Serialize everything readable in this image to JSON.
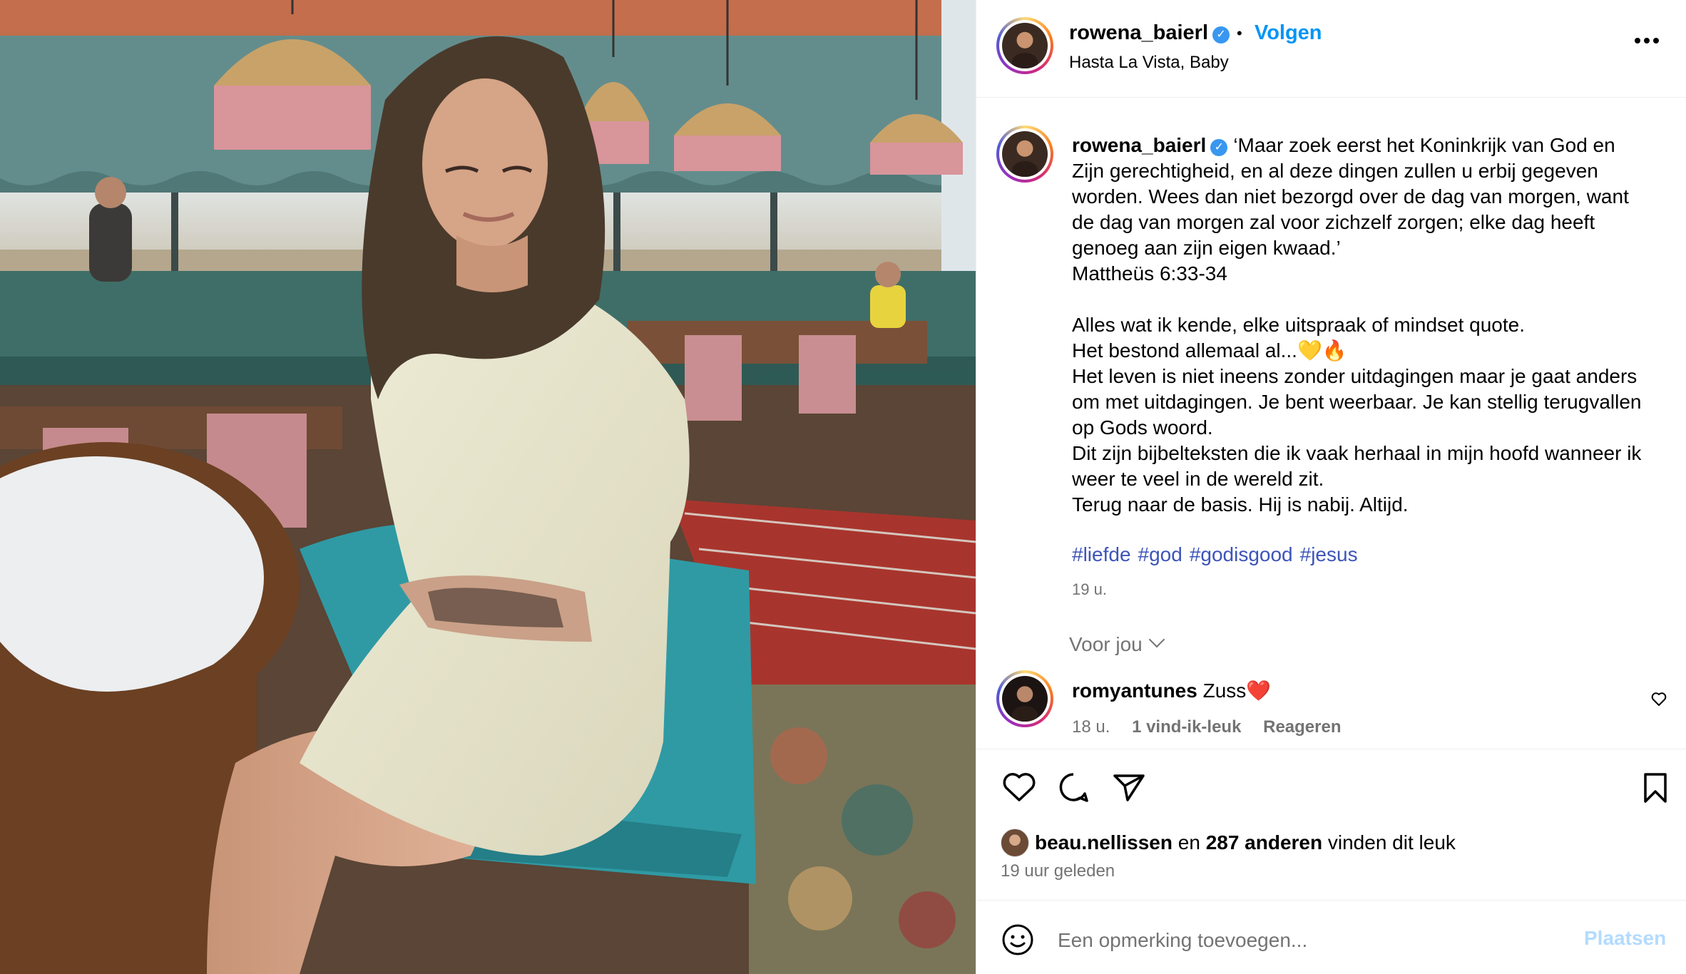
{
  "header": {
    "username": "rowena_baierl",
    "separator": "•",
    "follow_label": "Volgen",
    "subtitle": "Hasta La Vista, Baby"
  },
  "caption": {
    "username": "rowena_baierl",
    "lines": [
      "‘Maar zoek eerst het Koninkrijk van God en",
      "Zijn gerechtigheid, en al deze dingen zullen u erbij gegeven",
      "worden. Wees dan niet bezorgd over de dag van morgen, want",
      "de dag van morgen zal voor zichzelf zorgen; elke dag heeft",
      "genoeg aan zijn eigen kwaad.’",
      "Mattheüs 6:33-34",
      "",
      "Alles wat ik kende, elke uitspraak of mindset quote.",
      "Het bestond allemaal al...💛🔥",
      "Het leven is niet ineens zonder uitdagingen maar je gaat anders",
      "om met uitdagingen. Je bent weerbaar. Je kan stellig terugvallen",
      "op Gods woord.",
      "Dit zijn bijbelteksten die ik vaak herhaal in mijn hoofd wanneer ik",
      "weer te veel in de wereld zit.",
      "Terug naar de basis. Hij is nabij. Altijd."
    ],
    "hashtags": [
      "#liefde",
      "#god",
      "#godisgood",
      "#jesus"
    ],
    "time": "19 u."
  },
  "for_you": "Voor jou",
  "comment": {
    "username": "romyantunes",
    "text": "Zuss❤️",
    "time": "18 u.",
    "likes": "1 vind-ik-leuk",
    "reply": "Reageren"
  },
  "likes": {
    "user": "beau.nellissen",
    "and": "en",
    "count_text": "287 anderen",
    "suffix": "vinden dit leuk"
  },
  "post_time": "19 uur geleden",
  "comment_box": {
    "placeholder": "Een opmerking toevoegen...",
    "post_label": "Plaatsen"
  },
  "icons": {
    "more": "more-dots-icon",
    "verified": "verified-badge-icon",
    "like": "heart-icon",
    "comment": "comment-bubble-icon",
    "share": "paper-plane-icon",
    "save": "bookmark-icon",
    "emoji": "emoji-icon"
  },
  "colors": {
    "accent": "#0095f6",
    "hashtag": "#3d54b8",
    "muted": "#737373",
    "post_disabled": "#b3dbff"
  }
}
